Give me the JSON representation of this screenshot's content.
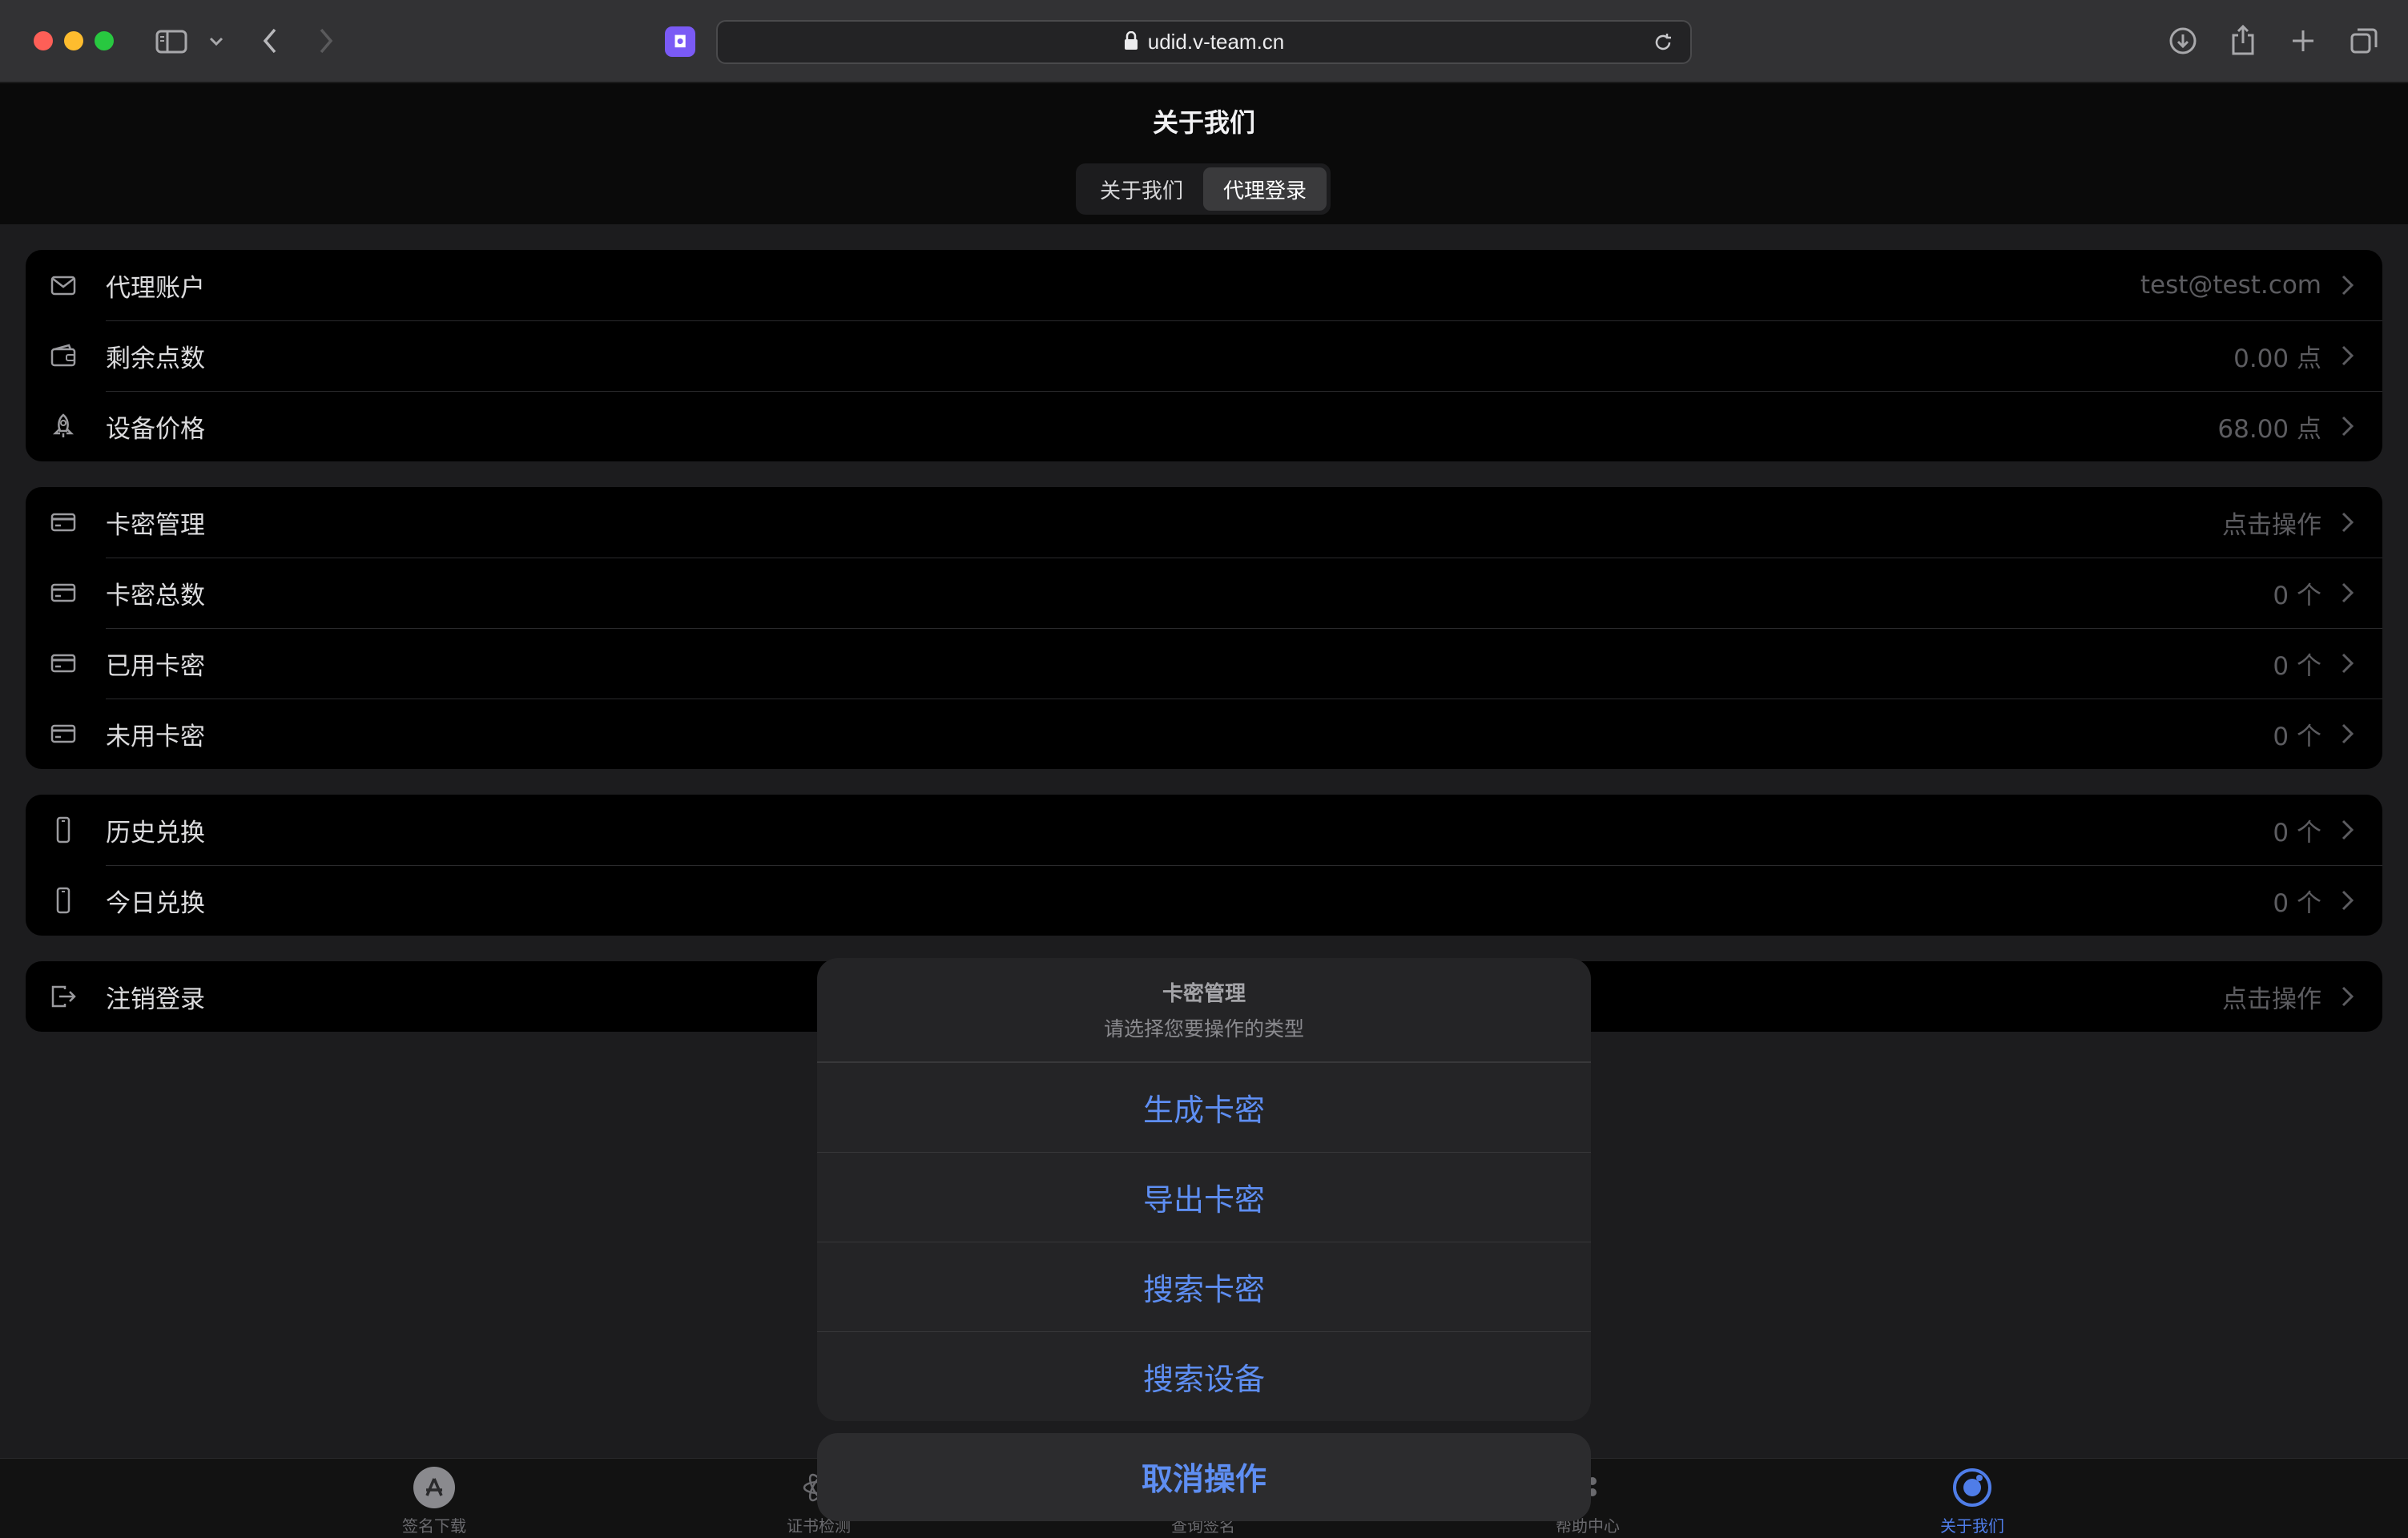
{
  "browser": {
    "url": "udid.v-team.cn"
  },
  "header": {
    "title": "关于我们",
    "tabs": [
      "关于我们",
      "代理登录"
    ]
  },
  "groups": {
    "account": [
      {
        "label": "代理账户",
        "value": "test@test.com",
        "icon": "mail-icon"
      },
      {
        "label": "剩余点数",
        "value": "0.00 点",
        "icon": "wallet-icon"
      },
      {
        "label": "设备价格",
        "value": "68.00 点",
        "icon": "rocket-icon"
      }
    ],
    "cards": [
      {
        "label": "卡密管理",
        "value": "点击操作",
        "icon": "card-icon"
      },
      {
        "label": "卡密总数",
        "value": "0 个",
        "icon": "card-icon"
      },
      {
        "label": "已用卡密",
        "value": "0 个",
        "icon": "card-icon"
      },
      {
        "label": "未用卡密",
        "value": "0 个",
        "icon": "card-icon"
      }
    ],
    "exchange": [
      {
        "label": "历史兑换",
        "value": "0 个",
        "icon": "phone-icon"
      },
      {
        "label": "今日兑换",
        "value": "0 个",
        "icon": "phone-icon"
      }
    ],
    "logout": [
      {
        "label": "注销登录",
        "value": "点击操作",
        "icon": "logout-icon"
      }
    ]
  },
  "action_sheet": {
    "title": "卡密管理",
    "message": "请选择您要操作的类型",
    "options": [
      "生成卡密",
      "导出卡密",
      "搜索卡密",
      "搜索设备"
    ],
    "cancel": "取消操作"
  },
  "tabbar": {
    "items": [
      {
        "label": "签名下载",
        "icon": "app-store-icon"
      },
      {
        "label": "证书检测",
        "icon": "atom-icon"
      },
      {
        "label": "查询签名",
        "icon": "search-icon"
      },
      {
        "label": "帮助中心",
        "icon": "help-icon"
      },
      {
        "label": "关于我们",
        "icon": "about-icon"
      }
    ],
    "active_index": 4
  },
  "colors": {
    "accent": "#5e8ef2",
    "tab_active": "#4f7de8"
  }
}
